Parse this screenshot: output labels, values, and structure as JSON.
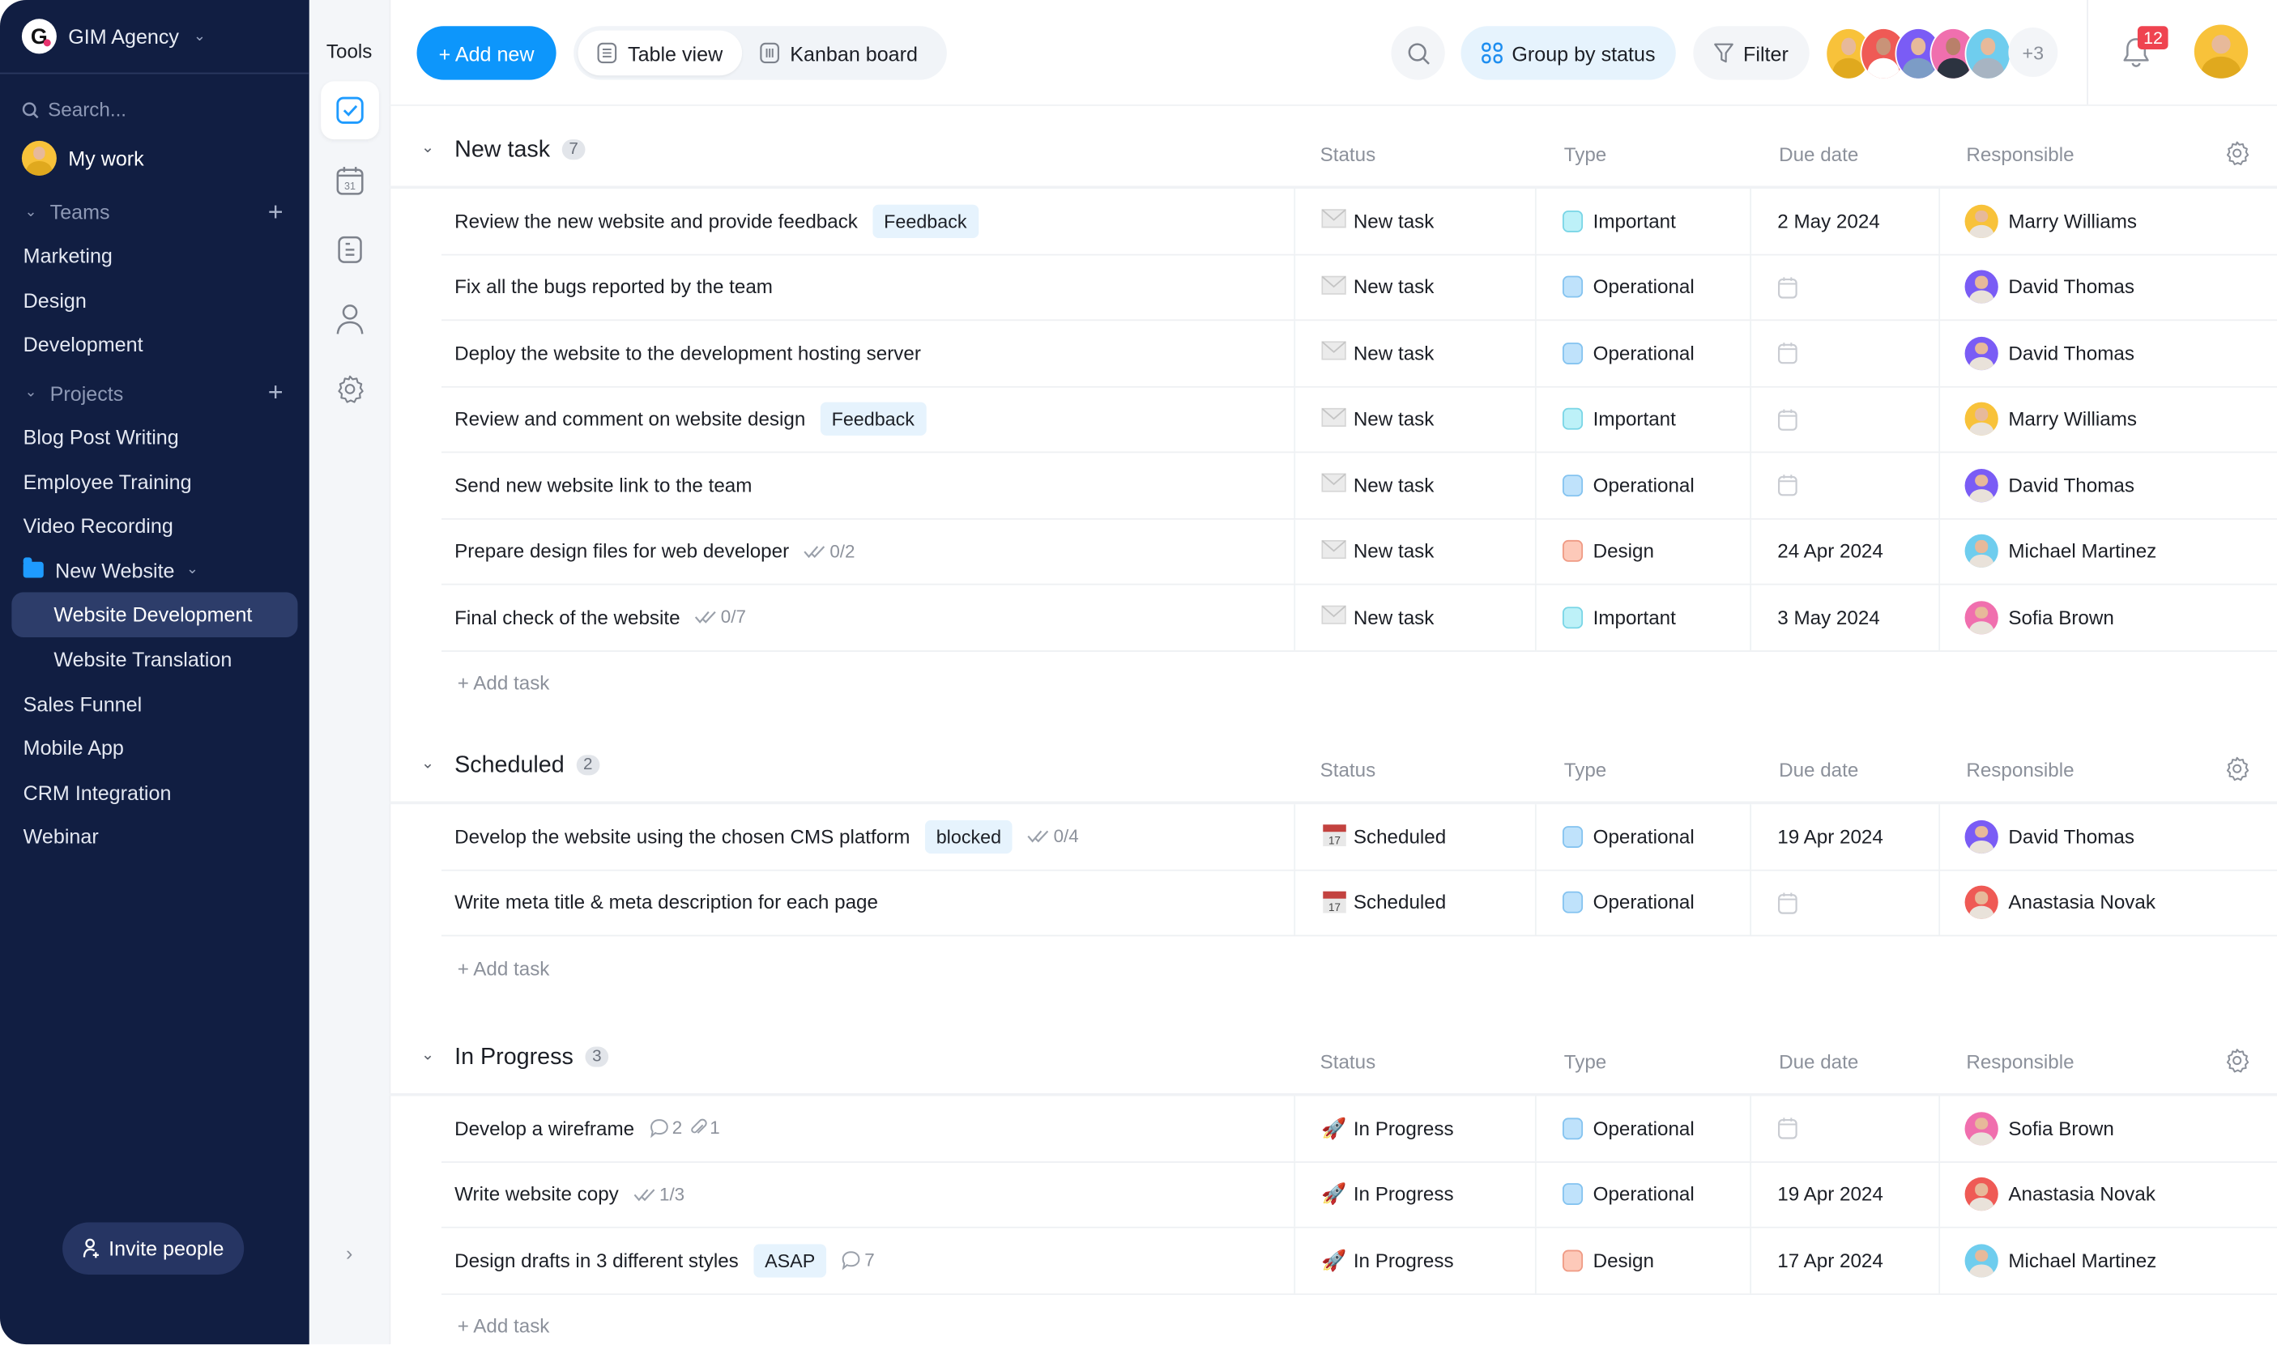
{
  "workspace": {
    "name": "GIM Agency",
    "logo_letter": "G"
  },
  "sidebar": {
    "search_placeholder": "Search...",
    "my_work": "My work",
    "teams_label": "Teams",
    "teams": [
      "Marketing",
      "Design",
      "Development"
    ],
    "projects_label": "Projects",
    "projects": [
      {
        "label": "Blog Post Writing"
      },
      {
        "label": "Employee Training"
      },
      {
        "label": "Video Recording"
      },
      {
        "label": "New Website",
        "folder": true,
        "children": [
          {
            "label": "Website Development",
            "active": true
          },
          {
            "label": "Website Translation"
          }
        ]
      },
      {
        "label": "Sales Funnel"
      },
      {
        "label": "Mobile App"
      },
      {
        "label": "CRM Integration"
      },
      {
        "label": "Webinar"
      }
    ],
    "invite_label": "Invite people"
  },
  "tools": {
    "title": "Tools",
    "items": [
      "tasks-icon",
      "calendar-icon",
      "notes-icon",
      "user-icon",
      "gear-icon"
    ],
    "calendar_day": "31"
  },
  "toolbar": {
    "add_new": "+ Add new",
    "views": [
      "Table view",
      "Kanban board"
    ],
    "active_view": "Table view",
    "group_by": "Group by status",
    "filter": "Filter",
    "team_more": "+3",
    "notifications": "12"
  },
  "colors": {
    "accent": "#0d96fb",
    "sidebar_bg": "#111e42",
    "badge": "#ef4350",
    "type_important": "#bdf1f8",
    "type_operational": "#bfe2fb",
    "type_design": "#fdc9b9"
  },
  "columns": [
    "Status",
    "Type",
    "Due date",
    "Responsible"
  ],
  "add_task_label": "+ Add task",
  "people": {
    "Marry Williams": "#f8c23a",
    "David Thomas": "#7a5cf5",
    "Michael Martinez": "#6fcdee",
    "Sofia Brown": "#f06fae",
    "Anastasia Novak": "#ef5a55"
  },
  "groups": [
    {
      "title": "New task",
      "count": "7",
      "rows": [
        {
          "name": "Review the new website and provide feedback",
          "tag": "Feedback",
          "status": "New task",
          "status_icon": "envelope",
          "type": "Important",
          "due": "2 May 2024",
          "responsible": "Marry Williams"
        },
        {
          "name": "Fix all the bugs reported by the team",
          "status": "New task",
          "status_icon": "envelope",
          "type": "Operational",
          "due": "",
          "responsible": "David Thomas"
        },
        {
          "name": "Deploy the website to the development hosting server",
          "status": "New task",
          "status_icon": "envelope",
          "type": "Operational",
          "due": "",
          "responsible": "David Thomas"
        },
        {
          "name": "Review and comment on website design",
          "tag": "Feedback",
          "status": "New task",
          "status_icon": "envelope",
          "type": "Important",
          "due": "",
          "responsible": "Marry Williams"
        },
        {
          "name": "Send new website link to the team",
          "status": "New task",
          "status_icon": "envelope",
          "type": "Operational",
          "due": "",
          "responsible": "David Thomas"
        },
        {
          "name": "Prepare design files for web developer",
          "subtasks": "0/2",
          "status": "New task",
          "status_icon": "envelope",
          "type": "Design",
          "due": "24 Apr 2024",
          "responsible": "Michael Martinez"
        },
        {
          "name": "Final check of the website",
          "subtasks": "0/7",
          "status": "New task",
          "status_icon": "envelope",
          "type": "Important",
          "due": "3 May 2024",
          "responsible": "Sofia Brown"
        }
      ]
    },
    {
      "title": "Scheduled",
      "count": "2",
      "rows": [
        {
          "name": "Develop the website using the chosen CMS platform",
          "tag": "blocked",
          "subtasks": "0/4",
          "status": "Scheduled",
          "status_icon": "calendar",
          "type": "Operational",
          "due": "19 Apr 2024",
          "responsible": "David Thomas"
        },
        {
          "name": "Write meta title & meta description for each page",
          "status": "Scheduled",
          "status_icon": "calendar",
          "type": "Operational",
          "due": "",
          "responsible": "Anastasia Novak"
        }
      ]
    },
    {
      "title": "In Progress",
      "count": "3",
      "rows": [
        {
          "name": "Develop a wireframe",
          "comments": "2",
          "attachments": "1",
          "status": "In Progress",
          "status_icon": "rocket",
          "type": "Operational",
          "due": "",
          "responsible": "Sofia Brown"
        },
        {
          "name": "Write website copy",
          "subtasks": "1/3",
          "status": "In Progress",
          "status_icon": "rocket",
          "type": "Operational",
          "due": "19 Apr 2024",
          "responsible": "Anastasia Novak"
        },
        {
          "name": "Design drafts in 3 different styles",
          "tag": "ASAP",
          "comments": "7",
          "status": "In Progress",
          "status_icon": "rocket",
          "type": "Design",
          "due": "17 Apr 2024",
          "responsible": "Michael Martinez"
        }
      ]
    }
  ]
}
